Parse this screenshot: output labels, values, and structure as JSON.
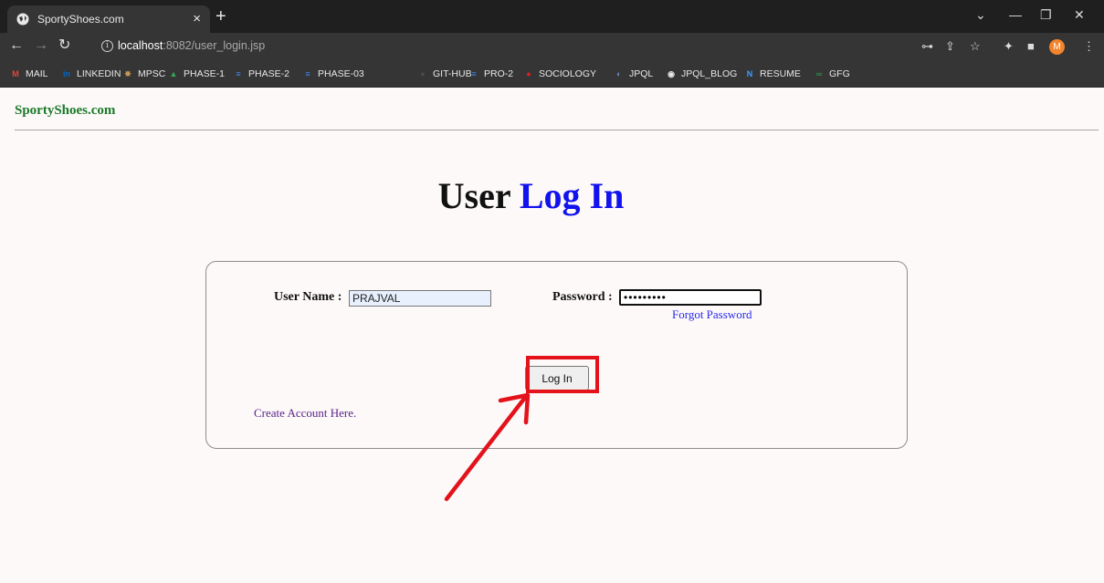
{
  "browser": {
    "tab_title": "SportyShoes.com",
    "url_prefix": "localhost",
    "url_suffix": ":8082/user_login.jsp",
    "avatar_initial": "M",
    "bookmarks": [
      {
        "label": "MAIL",
        "icon": "gmail-icon",
        "color": "#ea4335"
      },
      {
        "label": "LINKEDIN",
        "icon": "linkedin-icon",
        "color": "#0a66c2"
      },
      {
        "label": "MPSC",
        "icon": "emblem-icon",
        "color": "#c89b5a"
      },
      {
        "label": "PHASE-1",
        "icon": "drive-icon",
        "color": "#34a853"
      },
      {
        "label": "PHASE-2",
        "icon": "docs-icon",
        "color": "#4285f4"
      },
      {
        "label": "PHASE-03",
        "icon": "docs-icon",
        "color": "#4285f4"
      },
      {
        "label": "GIT-HUB",
        "icon": "github-icon",
        "color": "#4a4a4a"
      },
      {
        "label": "PRO-2",
        "icon": "docs-icon",
        "color": "#4285f4"
      },
      {
        "label": "SOCIOLOGY",
        "icon": "sociology-icon",
        "color": "#e02020"
      },
      {
        "label": "JPQL",
        "icon": "jpql-icon",
        "color": "#6a8fc8"
      },
      {
        "label": "JPQL_BLOG",
        "icon": "globe-icon",
        "color": "#e8e8e8"
      },
      {
        "label": "RESUME",
        "icon": "resume-icon",
        "color": "#3aa0ff"
      },
      {
        "label": "GFG",
        "icon": "gfg-icon",
        "color": "#2f8d46"
      }
    ]
  },
  "page": {
    "brand": "SportyShoes.com",
    "title_part1": "User",
    "title_part2": "Log In",
    "form": {
      "username_label": "User Name :",
      "username_value": "PRAJVAL",
      "password_label": "Password :",
      "password_value": "PRAJVAL12",
      "forgot_link": "Forgot Password",
      "login_button": "Log In",
      "create_link": "Create Account Here."
    }
  },
  "colors": {
    "brand_green": "#1b7a2a",
    "title_accent": "#1212ee",
    "annotation_red": "#e3121b"
  }
}
